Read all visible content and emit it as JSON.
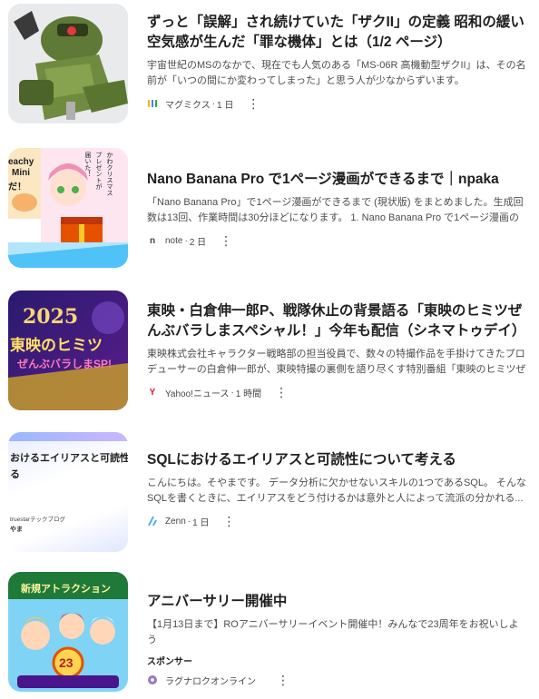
{
  "cards": [
    {
      "title": "ずっと「誤解」され続けていた「ザクII」の定義 昭和の緩い空気感が生んだ「罪な機体」とは（1/2 ページ）",
      "snippet": "宇宙世紀のMSのなかで、現在でも人気のある「MS-06R 高機動型ザクII」は、その名前が「いつの間にか変わってしまった」と思う人が少なからずいます。",
      "source": "マグミクス",
      "time": "1 日",
      "icon": "magmix-icon",
      "accent": "#6aa84f"
    },
    {
      "title": "Nano Banana Pro で1ページ漫画ができるまで｜npaka",
      "snippet": "「Nano Banana Pro」で1ページ漫画ができるまで (現状版) をまとめました。生成回数は13回、作業時間は30分ほどになります。 1. Nano Banana Pro で1ページ漫画の作成...",
      "source": "note",
      "time": "2 日",
      "icon": "note-icon",
      "thumb_text": [
        "eachy",
        "Mini",
        "だ！",
        "届いた！",
        "プレゼントが",
        "かわクリスマス"
      ]
    },
    {
      "title": "東映・白倉伸一郎P、戦隊休止の背景語る「東映のヒミツぜんぶバラしまスペシャル！」今年も配信（シネマトゥデイ）",
      "snippet": "東映株式会社キャラクター戦略部の担当役員で、数々の特撮作品を手掛けてきたプロデューサーの白倉伸一郎が、東映特撮の裏側を語り尽くす特別番組「東映のヒミツぜんぶ...",
      "source": "Yahoo!ニュース",
      "time": "1 時間",
      "icon": "yahoo-icon",
      "thumb_text": [
        "2025",
        "東映のヒミツ",
        "ぜんぶバラしまSP!"
      ]
    },
    {
      "title": "SQLにおけるエイリアスと可読性について考える",
      "snippet": "こんにちは。そやまです。 データ分析に欠かせないスキルの1つであるSQL。 そんなSQLを書くときに、エイリアスをどう付けるかは意外と人によって流派の分かれる...",
      "source": "Zenn",
      "time": "1 日",
      "icon": "zenn-icon",
      "thumb_text": [
        "おけるエイリアスと可読性",
        "る",
        "truestarテックブログ",
        "やま"
      ]
    },
    {
      "title": "アニバーサリー開催中",
      "snippet": "【1月13日まで】ROアニバーサリーイベント開催中！みんなで23周年をお祝いしよう",
      "sponsor": "スポンサー",
      "source": "ラグナロクオンライン",
      "icon": "ragnarok-icon",
      "thumb_text": [
        "新規アトラクション",
        "23"
      ]
    }
  ],
  "more_label": "⋮",
  "separator": "·"
}
